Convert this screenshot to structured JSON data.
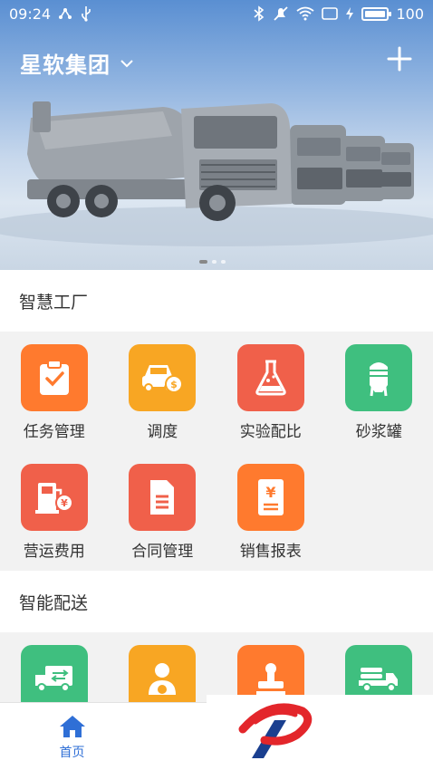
{
  "status_bar": {
    "time": "09:24",
    "battery_level": "100"
  },
  "header": {
    "company": "星软集团",
    "dropdown_icon": "chevron-down-icon",
    "add_icon": "plus-icon"
  },
  "banner": {
    "slides": 3,
    "active_slide": 1
  },
  "sections": [
    {
      "title": "智慧工厂",
      "items": [
        {
          "label": "任务管理",
          "icon": "clipboard-check-icon",
          "color": "#ff7a2e"
        },
        {
          "label": "调度",
          "icon": "truck-dispatch-icon",
          "color": "#f8a623"
        },
        {
          "label": "实验配比",
          "icon": "flask-icon",
          "color": "#f0604a"
        },
        {
          "label": "砂浆罐",
          "icon": "silo-icon",
          "color": "#3fbf7f"
        },
        {
          "label": "营运费用",
          "icon": "fuel-pump-icon",
          "color": "#f0604a"
        },
        {
          "label": "合同管理",
          "icon": "document-icon",
          "color": "#f0604a"
        },
        {
          "label": "销售报表",
          "icon": "sales-report-icon",
          "color": "#ff7a2e"
        }
      ]
    },
    {
      "title": "智能配送",
      "items": [
        {
          "label": "",
          "icon": "delivery-truck-icon",
          "color": "#3fbf7f"
        },
        {
          "label": "",
          "icon": "driver-icon",
          "color": "#f8a623"
        },
        {
          "label": "",
          "icon": "stamp-icon",
          "color": "#ff7a2e"
        },
        {
          "label": "",
          "icon": "flatbed-truck-icon",
          "color": "#3fbf7f"
        }
      ]
    }
  ],
  "bottom_nav": [
    {
      "label": "首页",
      "icon": "home-icon",
      "active": true
    },
    {
      "label": "(",
      "icon": "",
      "active": false
    }
  ],
  "colors": {
    "nav_active": "#2f6fd6",
    "nav_inactive": "#666666"
  }
}
